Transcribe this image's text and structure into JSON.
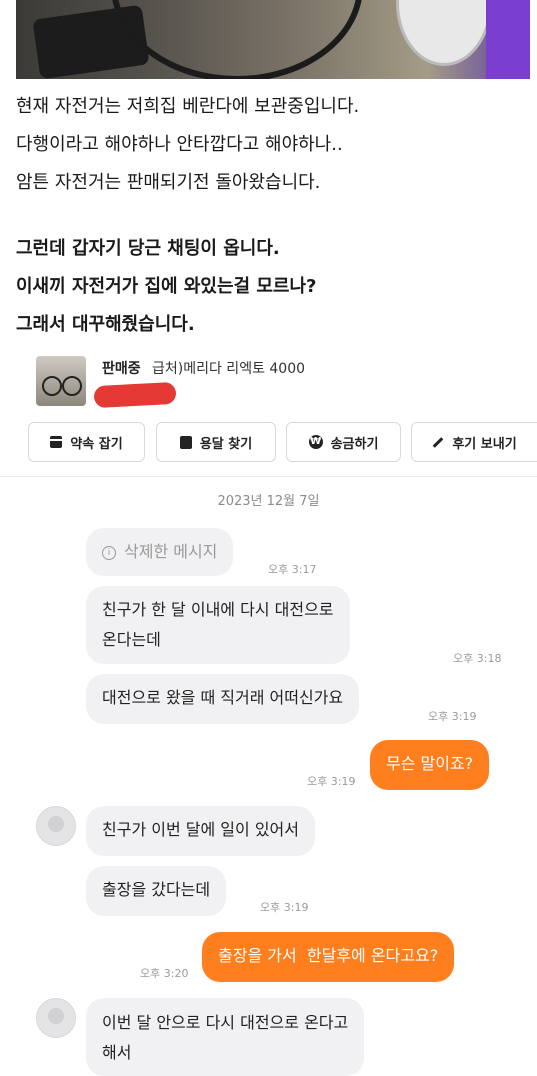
{
  "story": {
    "line1": "현재 자전거는 저희집 베란다에 보관중입니다.",
    "line2": "다행이라고 해야하나 안타깝다고 해야하나..",
    "line3": "암튼 자전거는 판매되기전 돌아왔습니다.",
    "line4": "그런데 갑자기 당근 채팅이 옵니다.",
    "line5": "이새끼 자전거가 집에 와있는걸 모르나?",
    "line6": "그래서 대꾸해줬습니다."
  },
  "listing": {
    "status": "판매중",
    "title": "급처)메리다 리엑토 4000"
  },
  "actions": [
    {
      "label": "약속 잡기",
      "icon": "calendar-icon"
    },
    {
      "label": "용달 찾기",
      "icon": "bag-icon"
    },
    {
      "label": "송금하기",
      "icon": "won-icon"
    },
    {
      "label": "후기 보내기",
      "icon": "pencil-icon"
    }
  ],
  "chat": {
    "date": "2023년 12월 7일",
    "messages": [
      {
        "text": "삭제한 메시지",
        "time": "오후 3:17"
      },
      {
        "text1": "친구가 한 달 이내에 다시 대전으로",
        "text2": "온다는데",
        "time": "오후 3:18"
      },
      {
        "text": "대전으로 왔을 때 직거래 어떠신가요",
        "time": "오후 3:19"
      },
      {
        "text": "무슨 말이죠?",
        "time": "오후 3:19"
      },
      {
        "text": "친구가 이번 달에 일이 있어서"
      },
      {
        "text": "출장을 갔다는데",
        "time": "오후 3:19"
      },
      {
        "text": "출장을 가서  한달후에 온다고요?",
        "time": "오후 3:20"
      },
      {
        "text1": "이번 달 안으로 다시 대전으로 온다고",
        "text2": "해서"
      }
    ]
  },
  "colors": {
    "accent": "#ff7e1d",
    "bubble_other": "#f1f1f4",
    "redaction": "#e53935"
  }
}
